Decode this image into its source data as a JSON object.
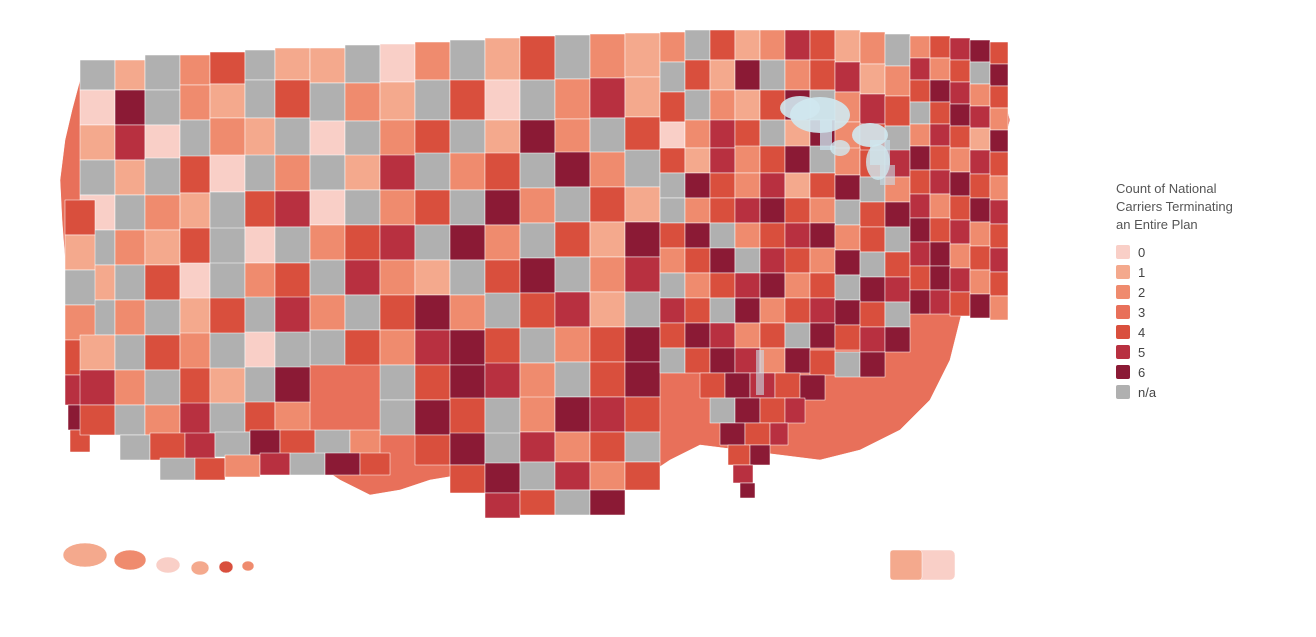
{
  "legend": {
    "title": "Count of National Carriers Terminating an Entire Plan",
    "title_line1": "Count of National",
    "title_line2": "Carriers Terminating",
    "title_line3": "an Entire Plan",
    "items": [
      {
        "label": "0",
        "color": "#f9cfc7"
      },
      {
        "label": "1",
        "color": "#f4a98d"
      },
      {
        "label": "2",
        "color": "#ef8b6e"
      },
      {
        "label": "3",
        "color": "#e8705a"
      },
      {
        "label": "4",
        "color": "#d94f3d"
      },
      {
        "label": "5",
        "color": "#b83040"
      },
      {
        "label": "6",
        "color": "#8b1a35"
      },
      {
        "label": "n/a",
        "color": "#b0b0b0"
      }
    ]
  },
  "map": {
    "alt": "Choropleth map of the United States showing count of national carriers terminating an entire plan by county"
  }
}
